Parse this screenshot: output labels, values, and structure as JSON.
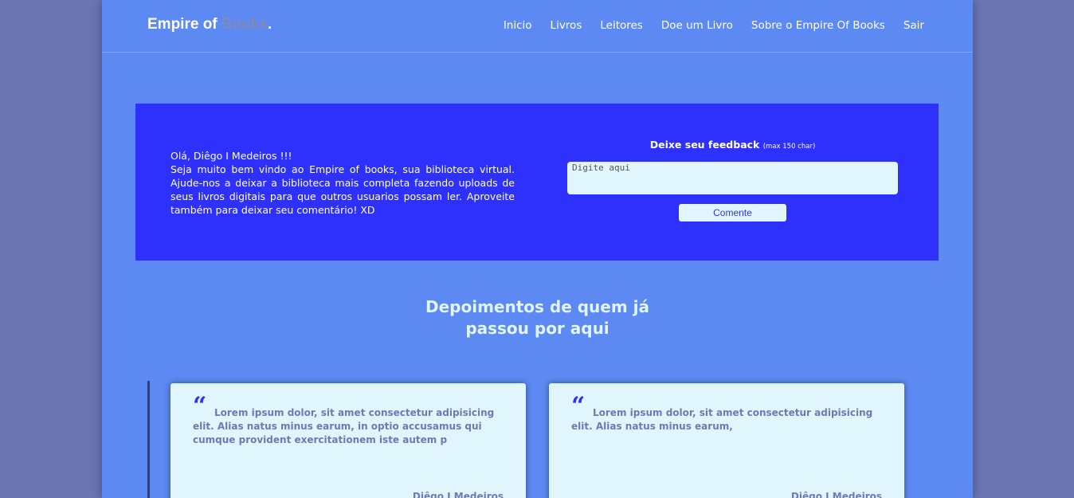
{
  "header": {
    "brand_prefix": "Empire of ",
    "brand_accent": "Books",
    "brand_suffix": ".",
    "nav": [
      "Inicio",
      "Livros",
      "Leitores",
      "Doe um Livro",
      "Sobre o Empire Of Books",
      "Sair"
    ]
  },
  "hero": {
    "greeting": "Olá, Diêgo I Medeiros !!!",
    "message": "Seja muito bem vindo ao Empire of books, sua biblioteca virtual. Ajude-nos a deixar a biblioteca mais completa fazendo uploads de seus livros digitais para que outros usuarios possam ler. Aproveite também para deixar seu comentário! XD",
    "feedback_title": "Deixe seu feedback",
    "feedback_limit": "(max 150 char)",
    "feedback_placeholder": "Digite aqui",
    "submit_label": "Comente"
  },
  "testimonials": {
    "title_line1": "Depoimentos de quem já",
    "title_line2": "passou por aqui",
    "quote_mark": "“",
    "cards": [
      {
        "text": "Lorem ipsum dolor, sit amet consectetur adipisicing elit. Alias natus minus earum, in optio accusamus qui cumque provident exercitationem iste autem p",
        "author": "Diêgo I Medeiros"
      },
      {
        "text": "Lorem ipsum dolor, sit amet consectetur adipisicing elit. Alias natus minus earum,",
        "author": "Diêgo I Medeiros"
      }
    ]
  },
  "colors": {
    "outer_background": "#6b75b2",
    "page_background": "#5c8af2",
    "hero_background": "#2e30fb",
    "card_background": "#e1f5fd",
    "card_text": "#6f79b4"
  }
}
